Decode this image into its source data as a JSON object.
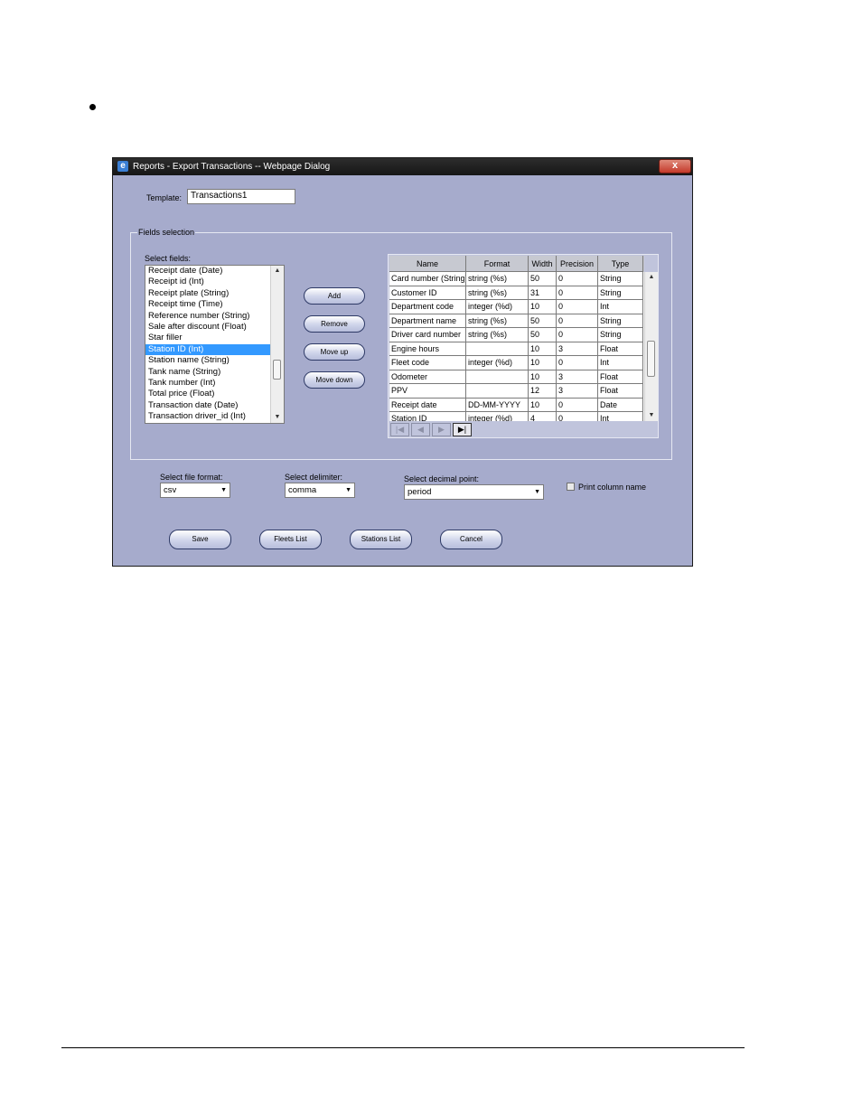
{
  "window": {
    "title": "Reports - Export Transactions -- Webpage Dialog",
    "close_label": "x"
  },
  "template": {
    "label": "Template:",
    "value": "Transactions1"
  },
  "fields_selection": {
    "legend": "Fields selection",
    "select_fields_label": "Select fields:",
    "list_items": [
      "Receipt date (Date)",
      "Receipt id (Int)",
      "Receipt plate (String)",
      "Receipt time (Time)",
      "Reference number (String)",
      "Sale after discount (Float)",
      "Star filler",
      "Station ID (Int)",
      "Station name (String)",
      "Tank name (String)",
      "Tank number (Int)",
      "Total price (Float)",
      "Transaction date (Date)",
      "Transaction driver_id (Int)"
    ],
    "selected_item": "Station ID (Int)"
  },
  "buttons": {
    "add": "Add",
    "remove": "Remove",
    "move_up": "Move up",
    "move_down": "Move down",
    "save": "Save",
    "fleets_list": "Fleets List",
    "stations_list": "Stations List",
    "cancel": "Cancel"
  },
  "grid": {
    "headers": [
      "Name",
      "Format",
      "Width",
      "Precision",
      "Type"
    ],
    "rows": [
      [
        "Card number (String)",
        "string (%s)",
        "50",
        "0",
        "String"
      ],
      [
        "Customer ID",
        "string (%s)",
        "31",
        "0",
        "String"
      ],
      [
        "Department code",
        "integer (%d)",
        "10",
        "0",
        "Int"
      ],
      [
        "Department name",
        "string (%s)",
        "50",
        "0",
        "String"
      ],
      [
        "Driver card number",
        "string (%s)",
        "50",
        "0",
        "String"
      ],
      [
        "Engine hours",
        "",
        "10",
        "3",
        "Float"
      ],
      [
        "Fleet code",
        "integer (%d)",
        "10",
        "0",
        "Int"
      ],
      [
        "Odometer",
        "",
        "10",
        "3",
        "Float"
      ],
      [
        "PPV",
        "",
        "12",
        "3",
        "Float"
      ],
      [
        "Receipt date",
        "DD-MM-YYYY",
        "10",
        "0",
        "Date"
      ],
      [
        "Station ID",
        "integer (%d)",
        "4",
        "0",
        "Int"
      ]
    ]
  },
  "file_format": {
    "label": "Select file format:",
    "value": "csv"
  },
  "delimiter": {
    "label": "Select delimiter:",
    "value": "comma"
  },
  "decimal_point": {
    "label": "Select decimal point:",
    "value": "period"
  },
  "print_column_name": {
    "label": "Print column name",
    "checked": false
  },
  "colors": {
    "dialog_bg": "#a6abcc",
    "selection": "#3399ff",
    "title_bar": "#1f1f1f",
    "close_red": "#c4392a"
  }
}
